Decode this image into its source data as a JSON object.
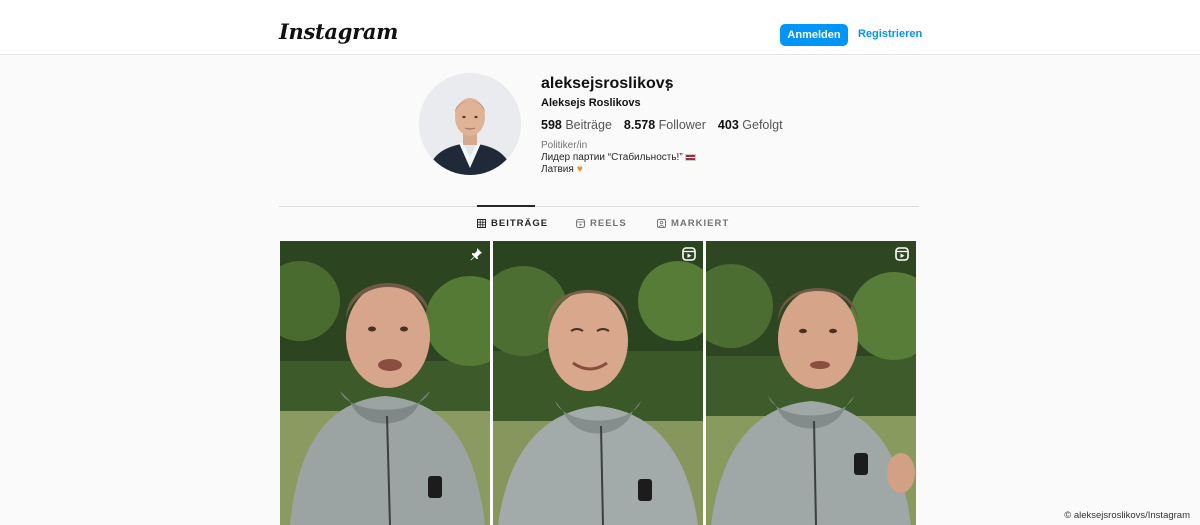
{
  "header": {
    "logo": "Instagram",
    "login_label": "Anmelden",
    "register_label": "Registrieren"
  },
  "profile": {
    "username": "aleksejsroslikovs",
    "full_name": "Aleksejs Roslikovs",
    "stats": [
      {
        "count": "598",
        "label": "Beiträge"
      },
      {
        "count": "8.578",
        "label": "Follower"
      },
      {
        "count": "403",
        "label": "Gefolgt"
      }
    ],
    "category": "Politiker/in",
    "bio_line1": "Лидер партии “Стабильность!”",
    "bio_line2": "Латвия"
  },
  "tabs": [
    {
      "label": "BEITRÄGE",
      "active": true,
      "icon": "grid-icon"
    },
    {
      "label": "REELS",
      "active": false,
      "icon": "reels-icon"
    },
    {
      "label": "MARKIERT",
      "active": false,
      "icon": "tagged-icon"
    }
  ],
  "posts": [
    {
      "badge": "pin-icon"
    },
    {
      "badge": "reel-icon"
    },
    {
      "badge": "reel-icon"
    }
  ],
  "credit": "© aleksejsroslikovs/Instagram",
  "colors": {
    "accent": "#0095f6",
    "background": "#fafafa",
    "text": "#262626",
    "muted": "#737373"
  }
}
